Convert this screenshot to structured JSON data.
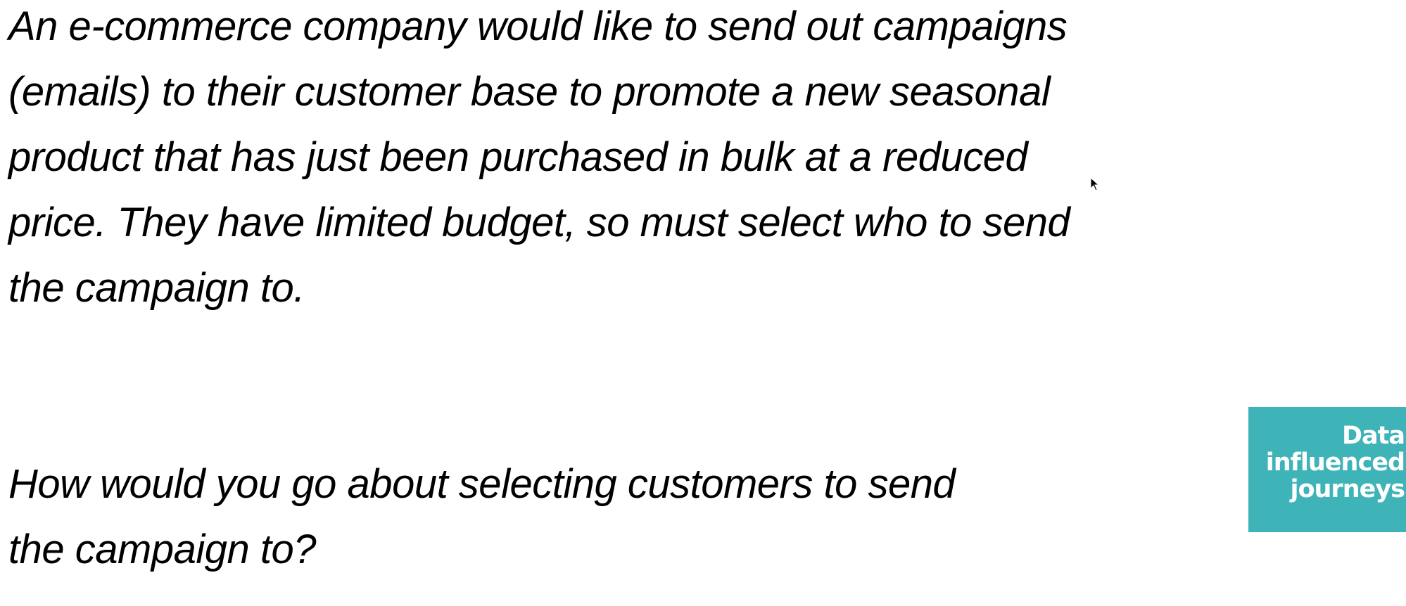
{
  "slide": {
    "paragraph1": [
      "An e-commerce company would like to send out campaigns",
      "(emails) to their customer base to promote a new seasonal",
      "product that has just been purchased in bulk at a reduced",
      "price. They have limited budget, so must select who to send",
      "the campaign to."
    ],
    "paragraph2": [
      "How would you go about selecting customers to send",
      "the campaign to?"
    ],
    "logo": {
      "lines": [
        "Data",
        "influenced",
        "journeys"
      ],
      "color": "#3fb4b8"
    }
  }
}
